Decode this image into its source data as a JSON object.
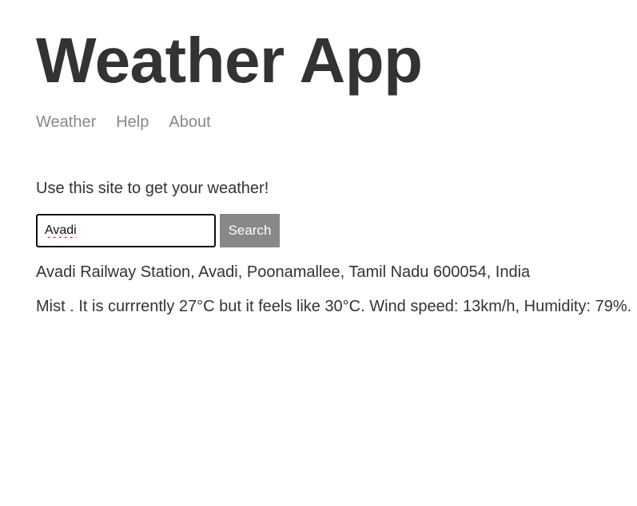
{
  "header": {
    "title": "Weather App",
    "nav": [
      {
        "label": "Weather"
      },
      {
        "label": "Help"
      },
      {
        "label": "About"
      }
    ]
  },
  "main": {
    "intro": "Use this site to get your weather!",
    "search": {
      "value": "Avadi",
      "placeholder": "",
      "button_label": "Search"
    },
    "result": {
      "location": "Avadi Railway Station, Avadi, Poonamallee, Tamil Nadu 600054, India",
      "forecast": "Mist . It is currrently 27°C but it feels like 30°C. Wind speed: 13km/h, Humidity: 79%."
    }
  },
  "colors": {
    "text": "#333333",
    "nav_link": "#888888",
    "button_bg": "#888888",
    "button_text": "#ffffff"
  }
}
